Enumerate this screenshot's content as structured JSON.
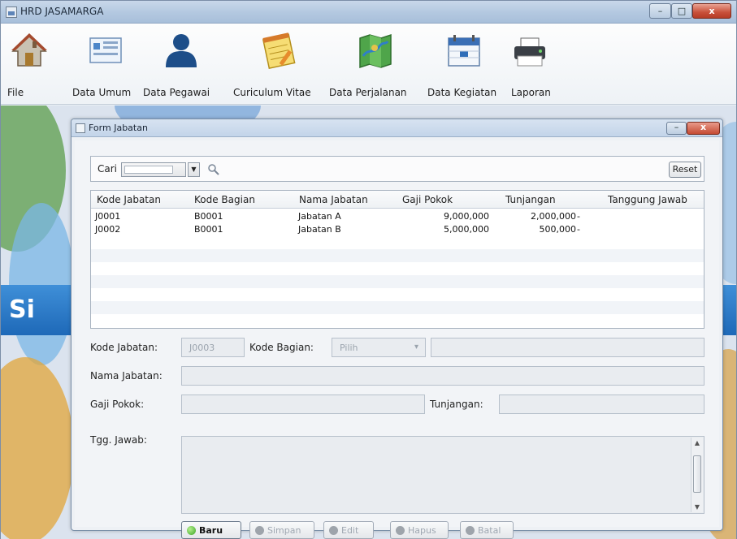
{
  "window": {
    "title": "HRD JASAMARGA",
    "minimize": "–",
    "maximize": "□",
    "close": "x"
  },
  "toolbar": {
    "items": [
      {
        "label": "File",
        "icon": "home-icon"
      },
      {
        "label": "Data Umum",
        "icon": "data-umum-icon"
      },
      {
        "label": "Data Pegawai",
        "icon": "person-icon"
      },
      {
        "label": "Curiculum Vitae",
        "icon": "notepad-icon"
      },
      {
        "label": "Data Perjalanan",
        "icon": "map-icon"
      },
      {
        "label": "Data Kegiatan",
        "icon": "calendar-icon"
      },
      {
        "label": "Laporan",
        "icon": "printer-icon"
      }
    ]
  },
  "background": {
    "banner_text": "Si",
    "banner_color": "#2a7ccb"
  },
  "form": {
    "title": "Form Jabatan",
    "search": {
      "label": "Cari",
      "combo_value": "",
      "reset_label": "Reset"
    },
    "table": {
      "columns": [
        "Kode Jabatan",
        "Kode Bagian",
        "Nama Jabatan",
        "Gaji Pokok",
        "Tunjangan",
        "Tanggung Jawab"
      ],
      "rows": [
        [
          "J0001",
          "B0001",
          "Jabatan A",
          "9,000,000",
          "2,000,000",
          "-"
        ],
        [
          "J0002",
          "B0001",
          "Jabatan B",
          "5,000,000",
          "500,000",
          "-"
        ]
      ]
    },
    "fields": {
      "kode_jabatan_label": "Kode Jabatan:",
      "kode_jabatan_value": "J0003",
      "kode_bagian_label": "Kode Bagian:",
      "kode_bagian_value": "Pilih",
      "nama_jabatan_label": "Nama Jabatan:",
      "gaji_pokok_label": "Gaji Pokok:",
      "tunjangan_label": "Tunjangan:",
      "tgg_jawab_label": "Tgg. Jawab:"
    },
    "buttons": {
      "baru": "Baru",
      "simpan": "Simpan",
      "edit": "Edit",
      "hapus": "Hapus",
      "batal": "Batal"
    }
  }
}
